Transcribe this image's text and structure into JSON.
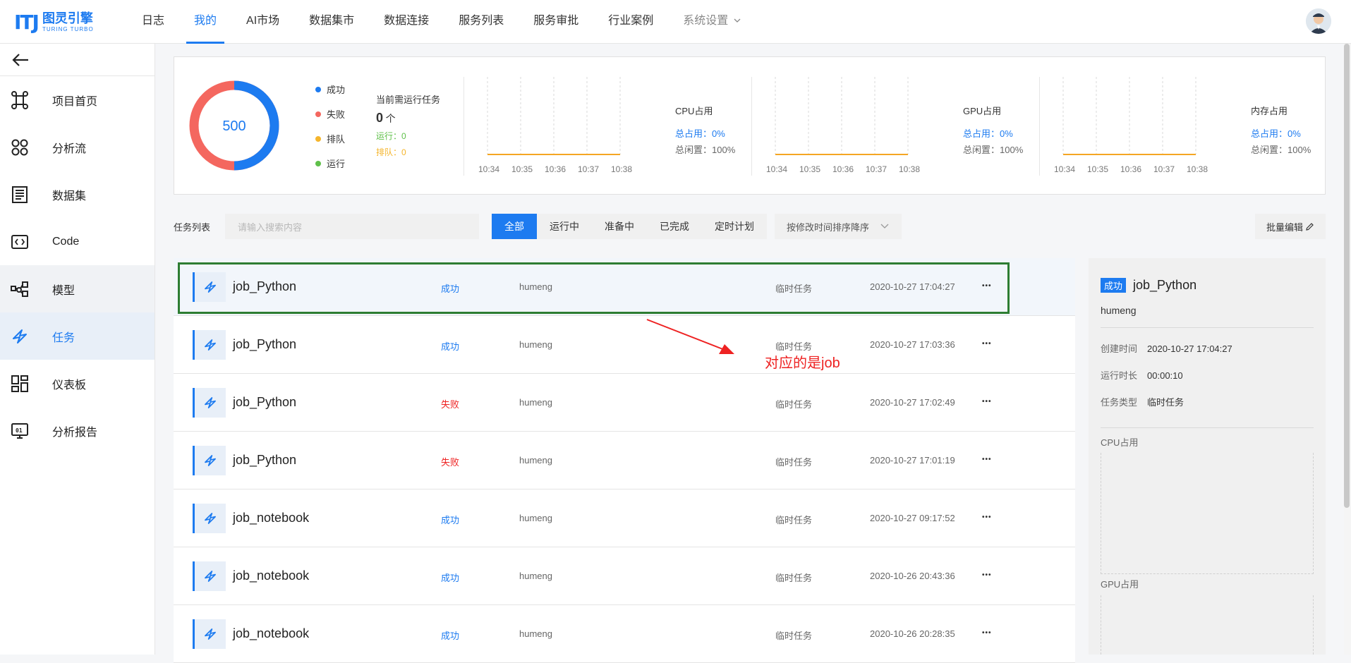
{
  "brand": {
    "mark": "ITJ",
    "cn": "图灵引擎",
    "en": "TURING TURBO"
  },
  "nav": [
    {
      "label": "日志",
      "active": false
    },
    {
      "label": "我的",
      "active": true
    },
    {
      "label": "AI市场",
      "active": false
    },
    {
      "label": "数据集市",
      "active": false
    },
    {
      "label": "数据连接",
      "active": false
    },
    {
      "label": "服务列表",
      "active": false
    },
    {
      "label": "服务审批",
      "active": false
    },
    {
      "label": "行业案例",
      "active": false
    },
    {
      "label": "系统设置",
      "active": false
    }
  ],
  "sidebar": {
    "items": [
      {
        "label": "项目首页",
        "icon": "command-icon"
      },
      {
        "label": "分析流",
        "icon": "flow-icon"
      },
      {
        "label": "数据集",
        "icon": "dataset-icon"
      },
      {
        "label": "Code",
        "icon": "code-icon"
      },
      {
        "label": "模型",
        "icon": "model-icon"
      },
      {
        "label": "任务",
        "icon": "task-icon"
      },
      {
        "label": "仪表板",
        "icon": "dashboard-icon"
      },
      {
        "label": "分析报告",
        "icon": "report-icon"
      }
    ]
  },
  "summary": {
    "total": "500",
    "success_fraction": 0.5,
    "legend": [
      {
        "label": "成功",
        "color": "#1d7bf0"
      },
      {
        "label": "失败",
        "color": "#f4675f"
      },
      {
        "label": "排队",
        "color": "#f5b52c"
      },
      {
        "label": "运行",
        "color": "#5fc04a"
      }
    ],
    "current_title": "当前需运行任务",
    "current_count": "0",
    "current_unit": "个",
    "running": "运行：0",
    "queued": "排队：0"
  },
  "monitors": [
    {
      "label": "CPU占用",
      "used": "总占用：0%",
      "idle": "总闲置：100%"
    },
    {
      "label": "GPU占用",
      "used": "总占用：0%",
      "idle": "总闲置：100%"
    },
    {
      "label": "内存占用",
      "used": "总占用：0%",
      "idle": "总闲置：100%"
    }
  ],
  "monitor_ticks": [
    "10:34",
    "10:35",
    "10:36",
    "10:37",
    "10:38"
  ],
  "toolbar": {
    "list_label": "任务列表",
    "search_placeholder": "请输入搜索内容",
    "tabs": [
      "全部",
      "运行中",
      "准备中",
      "已完成",
      "定时计划"
    ],
    "sort": "按修改时间排序降序",
    "batch": "批量编辑"
  },
  "jobs": [
    {
      "name": "job_Python",
      "status": "成功",
      "user": "humeng",
      "type": "临时任务",
      "time": "2020-10-27 17:04:27"
    },
    {
      "name": "job_Python",
      "status": "成功",
      "user": "humeng",
      "type": "临时任务",
      "time": "2020-10-27 17:03:36"
    },
    {
      "name": "job_Python",
      "status": "失败",
      "user": "humeng",
      "type": "临时任务",
      "time": "2020-10-27 17:02:49"
    },
    {
      "name": "job_Python",
      "status": "失败",
      "user": "humeng",
      "type": "临时任务",
      "time": "2020-10-27 17:01:19"
    },
    {
      "name": "job_notebook",
      "status": "成功",
      "user": "humeng",
      "type": "临时任务",
      "time": "2020-10-27 09:17:52"
    },
    {
      "name": "job_notebook",
      "status": "成功",
      "user": "humeng",
      "type": "临时任务",
      "time": "2020-10-26 20:43:36"
    },
    {
      "name": "job_notebook",
      "status": "成功",
      "user": "humeng",
      "type": "临时任务",
      "time": "2020-10-26 20:28:35"
    }
  ],
  "colors": {
    "success": "#1d7bf0",
    "failed": "#ee2222",
    "accent": "#1d7bf0",
    "annotation": "#ee2222",
    "highlight_box": "#2e7d32"
  },
  "annotation": "对应的是job",
  "detail": {
    "badge": "成功",
    "title": "job_Python",
    "user": "humeng",
    "created_label": "创建时间",
    "created": "2020-10-27 17:04:27",
    "duration_label": "运行时长",
    "duration": "00:00:10",
    "type_label": "任务类型",
    "type": "临时任务",
    "cpu_label": "CPU占用",
    "gpu_label": "GPU占用"
  }
}
